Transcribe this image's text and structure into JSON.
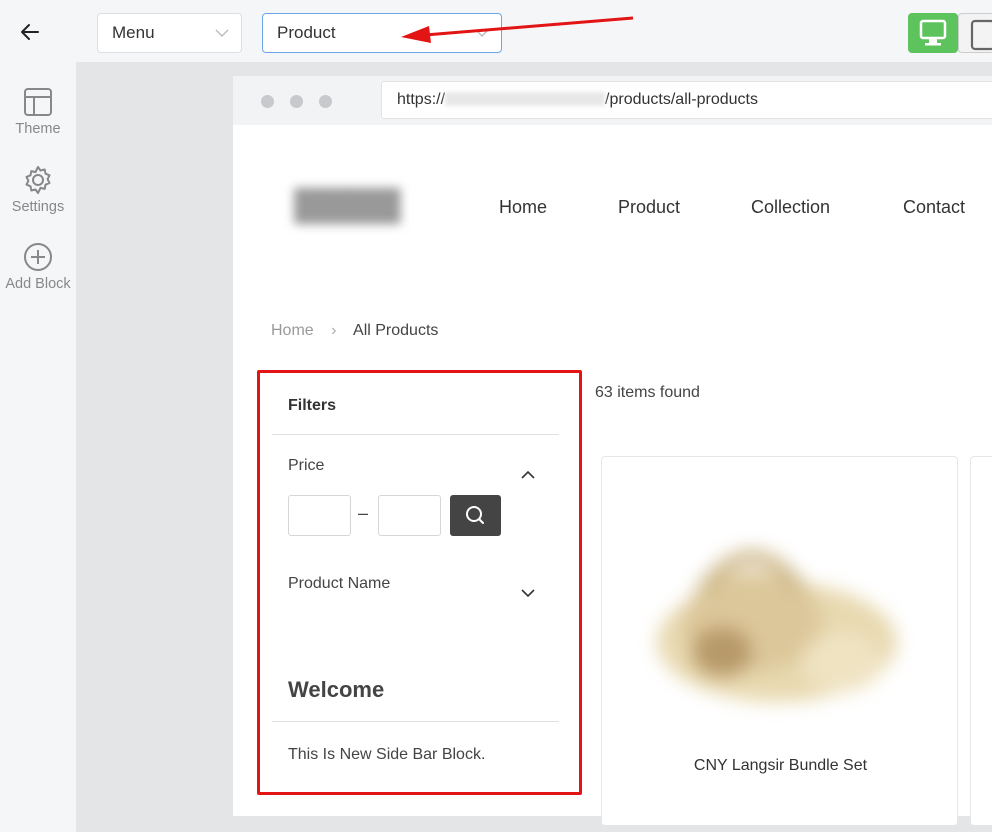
{
  "toolbar": {
    "menu_select_value": "Menu",
    "product_select_value": "Product"
  },
  "rail": {
    "items": [
      {
        "label": "Theme",
        "icon": "layout-icon"
      },
      {
        "label": "Settings",
        "icon": "gear-icon"
      },
      {
        "label": "Add Block",
        "icon": "plus-circle-icon"
      }
    ]
  },
  "browser": {
    "url_prefix": "https://",
    "url_path": "/products/all-products"
  },
  "site": {
    "nav": [
      "Home",
      "Product",
      "Collection",
      "Contact"
    ]
  },
  "breadcrumb": {
    "home": "Home",
    "current": "All Products"
  },
  "sidebar": {
    "filters_title": "Filters",
    "price_label": "Price",
    "price_separator": "–",
    "product_name_label": "Product Name",
    "welcome_title": "Welcome",
    "welcome_text": "This Is New Side Bar Block."
  },
  "results": {
    "count_text": "63 items found",
    "products": [
      {
        "name": "CNY Langsir Bundle Set"
      }
    ]
  },
  "colors": {
    "accent_green": "#5dc35d",
    "highlight_red": "#e21414",
    "search_button": "#444444"
  }
}
